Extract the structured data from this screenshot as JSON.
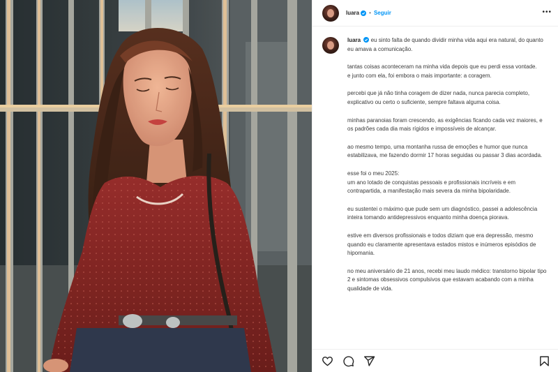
{
  "post": {
    "username": "luara",
    "separator": "•",
    "follow_label": "Seguir",
    "more_label": "•••",
    "caption_paragraphs": [
      "eu sinto falta de quando dividir minha vida aqui era natural, do quanto eu amava a comunicação.",
      "tantas coisas aconteceram na minha vida depois que eu perdi essa vontade.\ne junto com ela, foi embora o mais importante: a coragem.",
      "percebi que já não tinha coragem de dizer nada, nunca parecia completo, explicativo ou certo o suficiente, sempre faltava alguma coisa.",
      "minhas paranoias foram crescendo, as exigências ficando cada vez maiores, e os padrões cada dia mais rígidos e impossíveis de alcançar.",
      "ao mesmo tempo, uma montanha russa de emoções e humor que nunca estabilizava, me fazendo dormir 17 horas seguidas ou passar 3 dias acordada.",
      "esse foi o meu 2025:\num ano lotado de conquistas pessoais e profissionais incríveis e em contrapartida, a manifestação mais severa da minha bipolaridade.",
      "eu sustentei o máximo que pude sem um diagnóstico, passei a adolescência inteira tomando antidepressivos enquanto minha doença piorava.",
      "estive em diversos profissionais e todos diziam que era depressão, mesmo quando eu claramente apresentava estados mistos e inúmeros episódios de hipomania.",
      "no meu aniversário de 21 anos, recebi meu laudo médico: transtorno bipolar tipo 2 e sintomas obsessivos compulsivos que estavam acabando com a minha qualidade de vida."
    ]
  },
  "icons": {
    "avatar": "profile-avatar",
    "verified": "verified-badge-icon",
    "more": "more-options-icon",
    "like": "heart-icon",
    "comment": "comment-icon",
    "share": "send-icon",
    "save": "bookmark-icon"
  },
  "colors": {
    "accent": "#0095f6",
    "text": "#262626",
    "blouse": "#7a1a1c"
  }
}
